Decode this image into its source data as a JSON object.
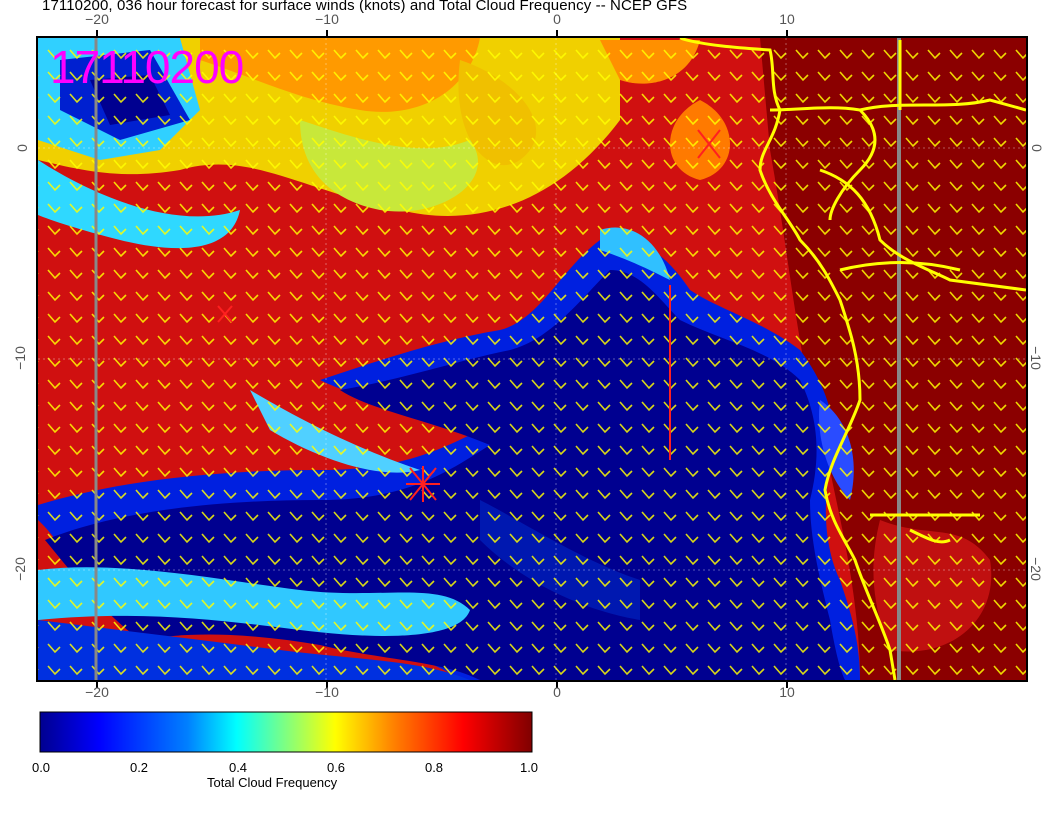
{
  "title": "17110200, 036 hour forecast for surface winds (knots) and Total Cloud Frequency -- NCEP GFS",
  "date_stamp": "17110200",
  "axes": {
    "top_lon_labels": [
      "−20",
      "−10",
      "0",
      "10"
    ],
    "bottom_lon_labels": [
      "−20",
      "−10",
      "0",
      "10"
    ],
    "left_lat_labels": [
      "0",
      "−10",
      "−20"
    ],
    "right_lat_labels": [
      "0",
      "−10",
      "−20"
    ]
  },
  "colorbar": {
    "label": "Total Cloud Frequency",
    "ticks": [
      "0.0",
      "0.2",
      "0.4",
      "0.6",
      "0.8",
      "1.0"
    ],
    "colors": [
      "#00008f",
      "#0000ff",
      "#0080ff",
      "#00ffff",
      "#80ff80",
      "#ffff00",
      "#ff8000",
      "#ff0000",
      "#800000"
    ]
  },
  "colors": {
    "coastline": "#ffff00",
    "wind_barbs": "#ffff00",
    "date_stamp": "#ff00ff",
    "markers": "#ff2020"
  },
  "icons": [
    "storm-marker-icon"
  ]
}
